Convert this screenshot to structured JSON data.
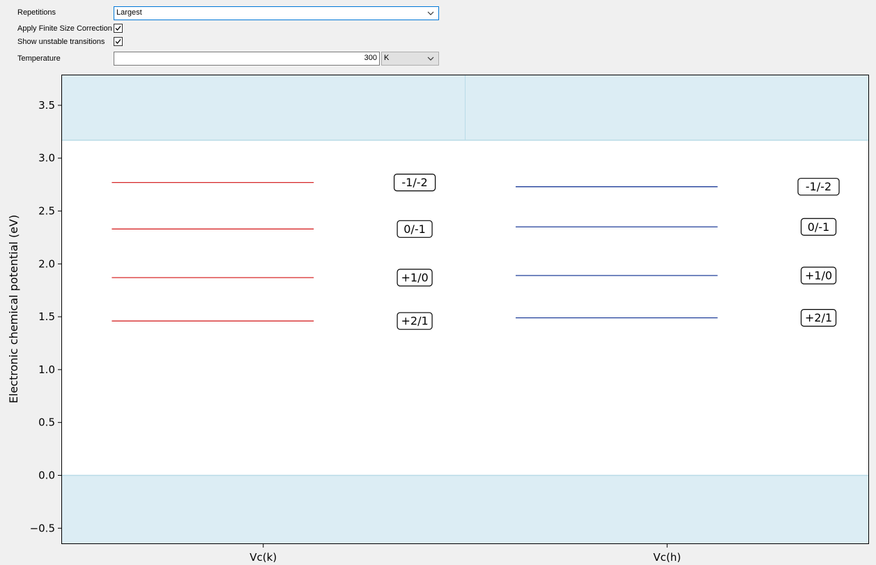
{
  "controls": {
    "repetitions_label": "Repetitions",
    "repetitions_value": "Largest",
    "finite_size_label": "Apply Finite Size Correction",
    "finite_size_checked": true,
    "unstable_label": "Show unstable transitions",
    "unstable_checked": true,
    "temperature_label": "Temperature",
    "temperature_value": "300",
    "temperature_unit": "K"
  },
  "colors": {
    "band_fill": "#dcedf4",
    "band_edge": "#b9dbe7",
    "series_k": "#d62728",
    "series_h": "#1f3e99"
  },
  "chart_data": {
    "type": "line",
    "ylabel": "Electronic chemical potential (eV)",
    "ylim": [
      -0.65,
      3.79
    ],
    "yticks": [
      -0.5,
      0.0,
      0.5,
      1.0,
      1.5,
      2.0,
      2.5,
      3.0,
      3.5
    ],
    "ytick_labels": [
      "−0.5",
      "0.0",
      "0.5",
      "1.0",
      "1.5",
      "2.0",
      "2.5",
      "3.0",
      "3.5"
    ],
    "categories": [
      "Vc(k)",
      "Vc(h)"
    ],
    "shaded_bands": [
      {
        "from": -0.65,
        "to": 0.0
      },
      {
        "from": 3.17,
        "to": 3.79
      }
    ],
    "series": [
      {
        "category": "Vc(k)",
        "levels": [
          {
            "label": "-1/-2",
            "value": 2.77
          },
          {
            "label": "0/-1",
            "value": 2.33
          },
          {
            "label": "+1/0",
            "value": 1.87
          },
          {
            "label": "+2/1",
            "value": 1.46
          }
        ]
      },
      {
        "category": "Vc(h)",
        "levels": [
          {
            "label": "-1/-2",
            "value": 2.73
          },
          {
            "label": "0/-1",
            "value": 2.35
          },
          {
            "label": "+1/0",
            "value": 1.89
          },
          {
            "label": "+2/1",
            "value": 1.49
          }
        ]
      }
    ]
  }
}
